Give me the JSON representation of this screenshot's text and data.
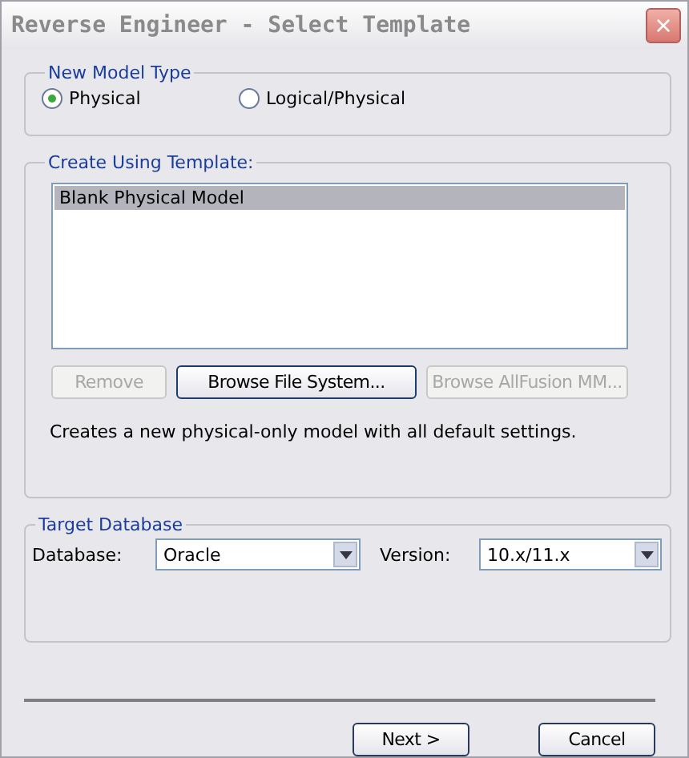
{
  "window": {
    "title": "Reverse Engineer - Select Template",
    "close": "×"
  },
  "model_type": {
    "legend": "New Model Type",
    "options": [
      {
        "label": "Physical",
        "selected": true
      },
      {
        "label": "Logical/Physical",
        "selected": false
      }
    ]
  },
  "template": {
    "legend": "Create Using Template:",
    "items": [
      {
        "label": "Blank Physical Model",
        "selected": true
      }
    ],
    "buttons": [
      {
        "label": "Remove",
        "disabled": true,
        "focused": false
      },
      {
        "label": "Browse File System...",
        "disabled": false,
        "focused": true
      },
      {
        "label": "Browse AllFusion MM...",
        "disabled": true,
        "focused": false
      }
    ],
    "description": "Creates a new physical-only model with all default settings."
  },
  "target": {
    "legend": "Target Database",
    "database": {
      "label": "Database:",
      "value": "Oracle"
    },
    "version": {
      "label": "Version:",
      "value": "10.x/11.x"
    }
  },
  "footer_buttons": [
    {
      "label": "Next >"
    },
    {
      "label": "Cancel"
    }
  ]
}
